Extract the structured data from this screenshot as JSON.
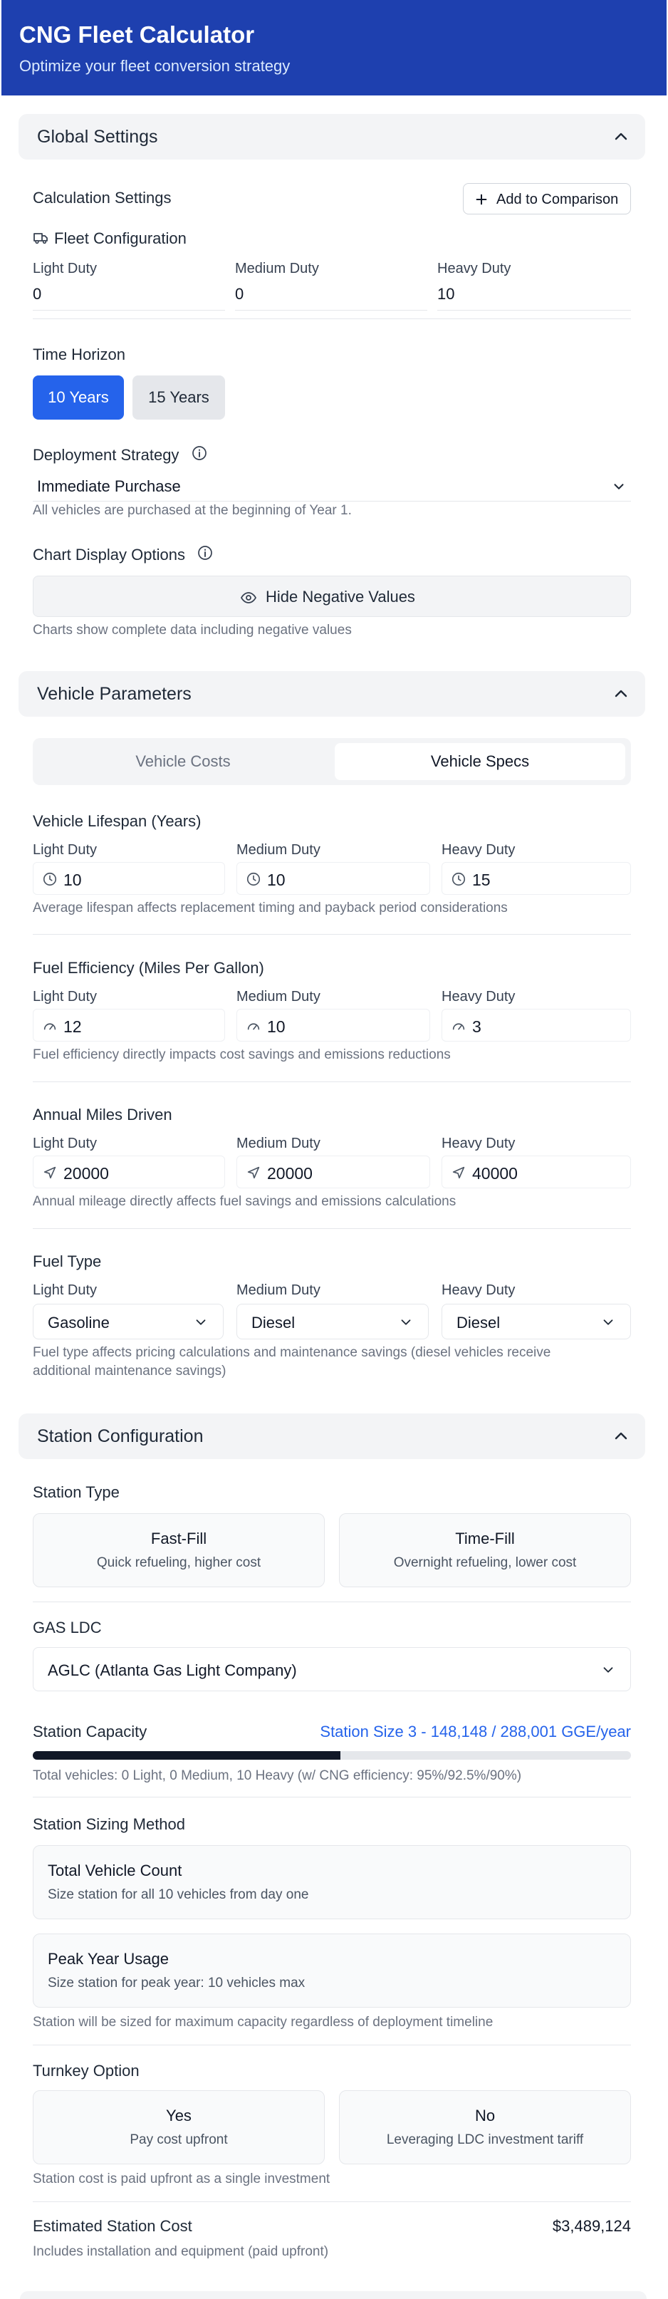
{
  "app": {
    "title": "CNG Fleet Calculator",
    "subtitle": "Optimize your fleet conversion strategy"
  },
  "global": {
    "section_title": "Global Settings",
    "calc_settings_label": "Calculation Settings",
    "add_comparison": "Add to Comparison",
    "fleet_config_label": "Fleet Configuration",
    "duty_labels": [
      "Light Duty",
      "Medium Duty",
      "Heavy Duty"
    ],
    "fleet_values": [
      "0",
      "0",
      "10"
    ],
    "time_horizon_label": "Time Horizon",
    "time_options": [
      "10 Years",
      "15 Years"
    ],
    "deployment_label": "Deployment Strategy",
    "deployment_value": "Immediate Purchase",
    "deployment_help": "All vehicles are purchased at the beginning of Year 1.",
    "chart_options_label": "Chart Display Options",
    "hide_negative": "Hide Negative Values",
    "chart_help": "Charts show complete data including negative values"
  },
  "vehicle": {
    "section_title": "Vehicle Parameters",
    "tabs": [
      "Vehicle Costs",
      "Vehicle Specs"
    ],
    "lifespan_label": "Vehicle Lifespan (Years)",
    "lifespan_values": [
      "10",
      "10",
      "15"
    ],
    "lifespan_help": "Average lifespan affects replacement timing and payback period considerations",
    "efficiency_label": "Fuel Efficiency (Miles Per Gallon)",
    "efficiency_values": [
      "12",
      "10",
      "3"
    ],
    "efficiency_help": "Fuel efficiency directly impacts cost savings and emissions reductions",
    "miles_label": "Annual Miles Driven",
    "miles_values": [
      "20000",
      "20000",
      "40000"
    ],
    "miles_help": "Annual mileage directly affects fuel savings and emissions calculations",
    "fuel_type_label": "Fuel Type",
    "fuel_values": [
      "Gasoline",
      "Diesel",
      "Diesel"
    ],
    "fuel_help_1": "Fuel type affects pricing calculations and maintenance savings (diesel vehicles receive",
    "fuel_help_2": "additional maintenance savings)"
  },
  "station": {
    "section_title": "Station Configuration",
    "type_label": "Station Type",
    "types": [
      {
        "title": "Fast-Fill",
        "desc": "Quick refueling, higher cost"
      },
      {
        "title": "Time-Fill",
        "desc": "Overnight refueling, lower cost"
      }
    ],
    "ldc_label": "GAS LDC",
    "ldc_value": "AGLC (Atlanta Gas Light Company)",
    "capacity_label": "Station Capacity",
    "capacity_value": "Station Size 3 - 148,148 / 288,001 GGE/year",
    "capacity_fraction": 0.514,
    "capacity_help": "Total vehicles: 0 Light, 0 Medium, 10 Heavy (w/ CNG efficiency: 95%/92.5%/90%)",
    "sizing_label": "Station Sizing Method",
    "sizing_options": [
      {
        "title": "Total Vehicle Count",
        "desc": "Size station for all 10 vehicles from day one"
      },
      {
        "title": "Peak Year Usage",
        "desc": "Size station for peak year: 10 vehicles max"
      }
    ],
    "sizing_help": "Station will be sized for maximum capacity regardless of deployment timeline",
    "turnkey_label": "Turnkey Option",
    "turnkey_options": [
      {
        "title": "Yes",
        "desc": "Pay cost upfront"
      },
      {
        "title": "No",
        "desc": "Leveraging LDC investment tariff"
      }
    ],
    "turnkey_help": "Station cost is paid upfront as a single investment",
    "est_cost_label": "Estimated Station Cost",
    "est_cost_value": "$3,489,124",
    "est_cost_help": "Includes installation and equipment (paid upfront)"
  },
  "colors": {
    "header": "#1e40af",
    "primary": "#2563eb",
    "capacity_text": "#2563eb",
    "bar_fill": "#111827",
    "bar_track": "#e5e7eb"
  }
}
